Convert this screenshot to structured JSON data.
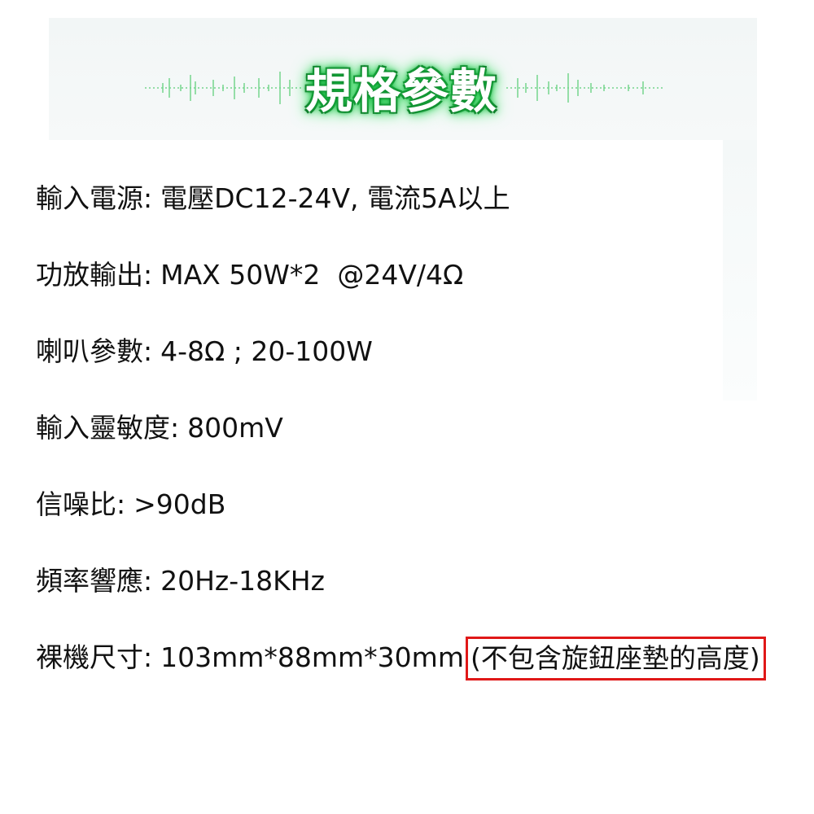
{
  "header": {
    "title": "規格參數",
    "title_glow_color": "#1fd44c",
    "title_outline_color": "#0a5a1e"
  },
  "specs": [
    {
      "label": "輸入電源",
      "sep": ":",
      "value": "電壓DC12-24V, 電流5A以上"
    },
    {
      "label": "功放輸出",
      "sep": ":",
      "value": "MAX 50W*2  @24V/4Ω"
    },
    {
      "label": "喇叭參數",
      "sep": ":",
      "value": "4-8Ω ; 20-100W"
    },
    {
      "label": "輸入靈敏度",
      "sep": ":",
      "value": "800mV"
    },
    {
      "label": "信噪比",
      "sep": ":",
      "value": ">90dB"
    },
    {
      "label": "頻率響應",
      "sep": ":",
      "value": "20Hz-18KHz"
    },
    {
      "label": "裸機尺寸",
      "sep": ":",
      "value": "103mm*88mm*30mm",
      "note": "(不包含旋鈕座墊的高度)"
    }
  ],
  "colors": {
    "note_border": "#e01818",
    "text": "#111111"
  }
}
